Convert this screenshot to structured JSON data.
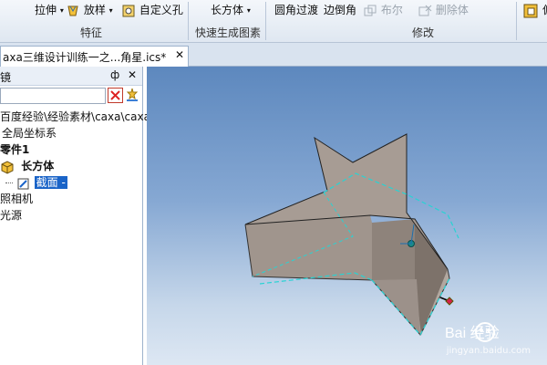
{
  "ribbon": {
    "extrude_label": "拉伸",
    "loft_label": "放样",
    "custom_hole_label": "自定义孔",
    "feature_group": "特征",
    "box_label": "长方体",
    "quick_gen_group": "快速生成图素",
    "fillet_label": "圆角过渡",
    "chamfer_label": "边倒角",
    "boolean_label": "布尔",
    "delete_body_label": "删除体",
    "modify_group": "修改"
  },
  "tab": {
    "title": "axa三维设计训练一之...角星.ics*",
    "close": "✕"
  },
  "panel": {
    "title": "镜",
    "pin": "ф",
    "close": "✕",
    "tree": [
      {
        "label": "百度经验\\经验素材\\caxa\\caxa"
      },
      {
        "label": "全局坐标系"
      },
      {
        "label": "零件1"
      },
      {
        "label": "长方体"
      },
      {
        "label": "截面 -"
      },
      {
        "label": "照相机"
      },
      {
        "label": "光源"
      }
    ]
  },
  "viewport": {
    "watermark_brand": "Bai 经验",
    "watermark_url": "jingyan.baidu.com"
  },
  "colors": {
    "star_top": "#a59a92",
    "star_side": "#8a7e76",
    "edge_highlight": "#28d3d3",
    "selection": "#1a64c8"
  }
}
